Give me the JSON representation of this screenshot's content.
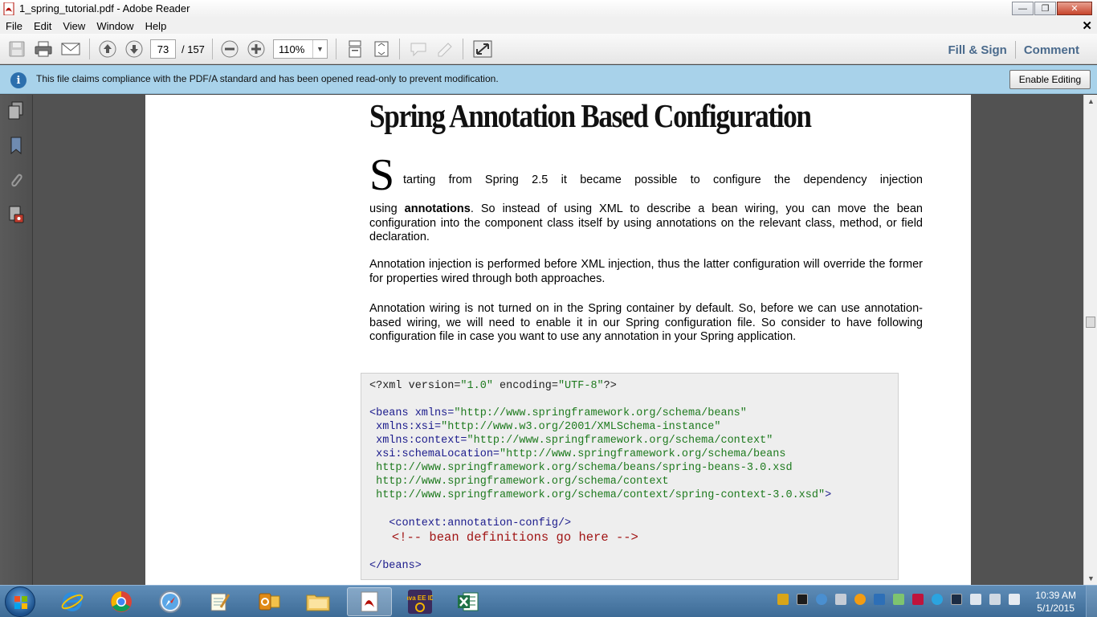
{
  "window": {
    "title": "1_spring_tutorial.pdf - Adobe Reader"
  },
  "menu": [
    "File",
    "Edit",
    "View",
    "Window",
    "Help"
  ],
  "toolbar": {
    "page_current": "73",
    "page_total": "/ 157",
    "zoom": "110%",
    "fill_sign": "Fill & Sign",
    "comment": "Comment"
  },
  "infobar": {
    "icon": "i",
    "message": "This file claims compliance with the PDF/A standard and has been opened read-only to prevent modification.",
    "enable_editing": "Enable Editing"
  },
  "document": {
    "title": "Spring Annotation Based Configuration",
    "dropcap": "S",
    "first_line": "tarting from Spring 2.5 it became possible to configure the dependency injection",
    "p1_pre": "using ",
    "p1_bold": "annotations",
    "p1_post": ". So instead of using XML to describe a bean wiring, you can move the bean configuration into the component class itself by using annotations on the relevant class, method, or field declaration.",
    "p2": "Annotation injection is performed before XML injection, thus the latter configuration will override the former for properties wired through both approaches.",
    "p3": "Annotation wiring is not turned on in the Spring container by default. So, before we can use annotation-based wiring, we will need to enable it in our Spring configuration file. So consider to have following configuration file in case you want to use any annotation in your Spring application.",
    "code": {
      "l1_a": "<?xml version=",
      "l1_b": "\"1.0\"",
      "l1_c": " encoding=",
      "l1_d": "\"UTF-8\"",
      "l1_e": "?>",
      "l2_a": "<beans xmlns=",
      "l2_b": "\"http://www.springframework.org/schema/beans\"",
      "l3_a": " xmlns:xsi=",
      "l3_b": "\"http://www.w3.org/2001/XMLSchema-instance\"",
      "l4_a": " xmlns:context=",
      "l4_b": "\"http://www.springframework.org/schema/context\"",
      "l5_a": " xsi:schemaLocation=",
      "l5_b": "\"http://www.springframework.org/schema/beans",
      "l6": " http://www.springframework.org/schema/beans/spring-beans-3.0.xsd",
      "l7": " http://www.springframework.org/schema/context",
      "l8_a": " http://www.springframework.org/schema/context/spring-context-3.0.xsd\"",
      "l8_b": ">",
      "l9": "   <context:annotation-config/>",
      "l10": "   <!-- bean definitions go here -->",
      "l11": "</beans>"
    }
  },
  "taskbar": {
    "clock_time": "10:39 AM",
    "clock_date": "5/1/2015",
    "java_label": "Java EE IDE"
  }
}
